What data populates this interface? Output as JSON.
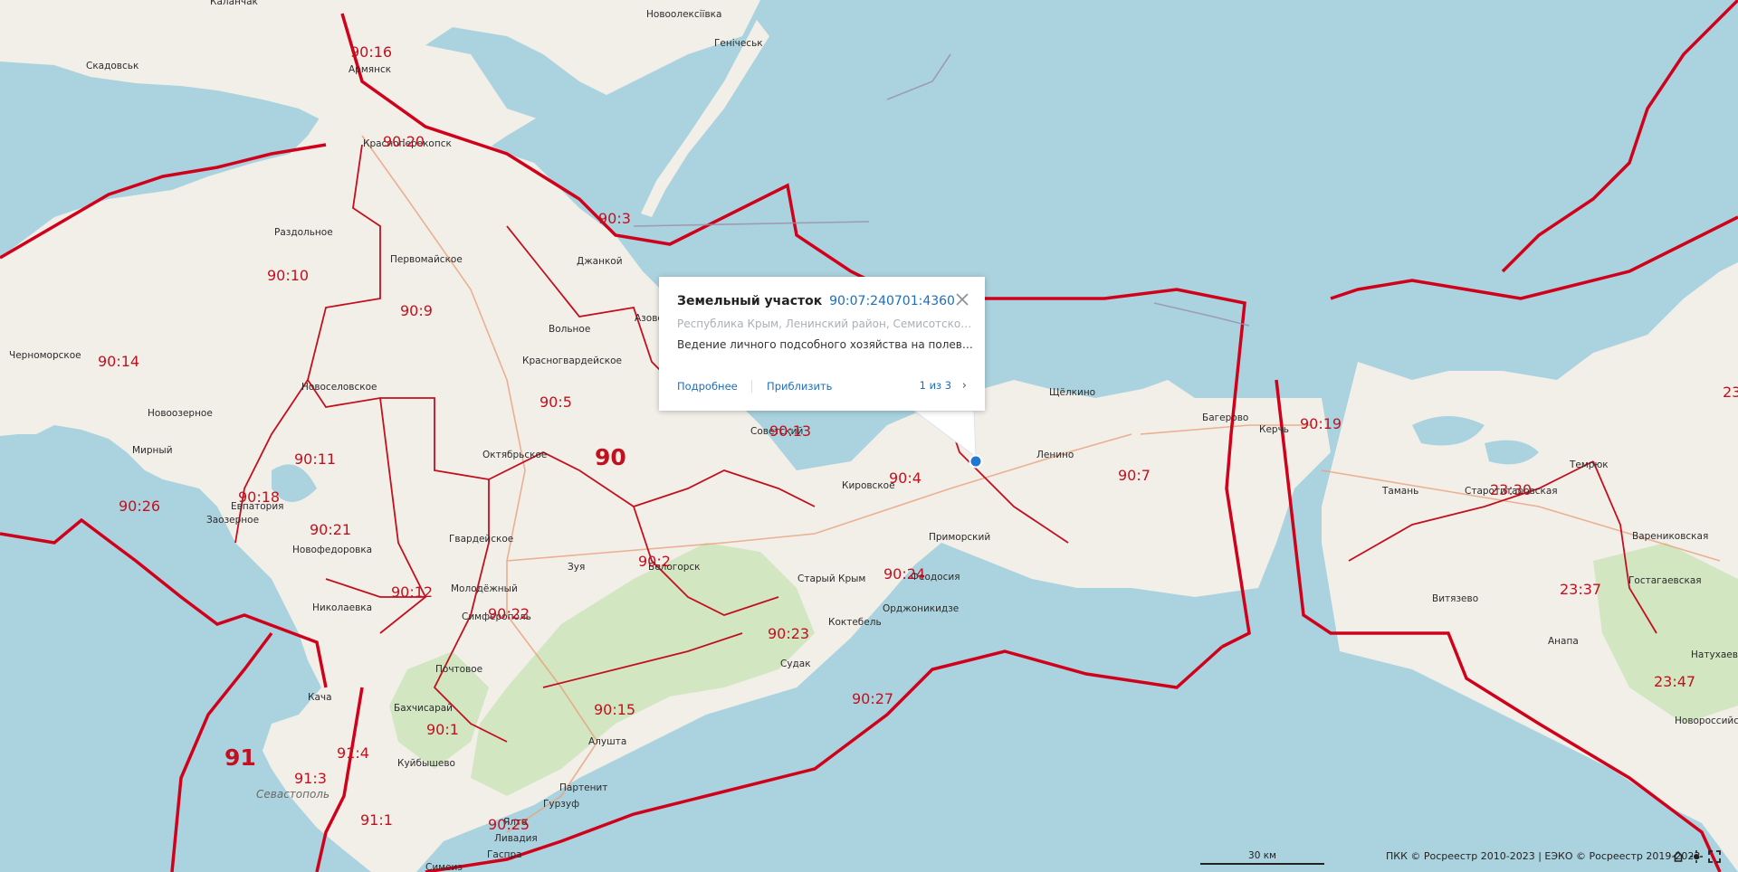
{
  "map": {
    "towns": [
      {
        "text": "Каланчак"
      },
      {
        "text": "Новоолексіївка"
      },
      {
        "text": "Генічеськ"
      },
      {
        "text": "Скадовськ"
      },
      {
        "text": "Армянск"
      },
      {
        "text": "Красноперекопск"
      },
      {
        "text": "Раздольное"
      },
      {
        "text": "Первомайское"
      },
      {
        "text": "Джанкой"
      },
      {
        "text": "Вольное"
      },
      {
        "text": "Азовское"
      },
      {
        "text": "Черноморское"
      },
      {
        "text": "Красногвардейское"
      },
      {
        "text": "Новоселовское"
      },
      {
        "text": "Новоозерное"
      },
      {
        "text": "Мирный"
      },
      {
        "text": "Октябрьское"
      },
      {
        "text": "Советский"
      },
      {
        "text": "Кировское"
      },
      {
        "text": "Ленино"
      },
      {
        "text": "Щёлкино"
      },
      {
        "text": "Багерово"
      },
      {
        "text": "Керчь"
      },
      {
        "text": "Евпатория"
      },
      {
        "text": "Заозерное"
      },
      {
        "text": "Новофедоровка"
      },
      {
        "text": "Гвардейское"
      },
      {
        "text": "Приморский"
      },
      {
        "text": "Зуя"
      },
      {
        "text": "Белогорск"
      },
      {
        "text": "Старый Крым"
      },
      {
        "text": "Феодосия"
      },
      {
        "text": "Орджоникидзе"
      },
      {
        "text": "Николаевка"
      },
      {
        "text": "Молодёжный"
      },
      {
        "text": "Симферополь"
      },
      {
        "text": "Коктебель"
      },
      {
        "text": "Почтовое"
      },
      {
        "text": "Судак"
      },
      {
        "text": "Кача"
      },
      {
        "text": "Бахчисарай"
      },
      {
        "text": "Куйбышево"
      },
      {
        "text": "Алушта"
      },
      {
        "text": "Севастополь"
      },
      {
        "text": "Партенит"
      },
      {
        "text": "Гурзуф"
      },
      {
        "text": "Ялта"
      },
      {
        "text": "Ливадия"
      },
      {
        "text": "Гаспра"
      },
      {
        "text": "Симеиз"
      },
      {
        "text": "Тамань"
      },
      {
        "text": "Старотитаровская"
      },
      {
        "text": "Темрюк"
      },
      {
        "text": "Варениковская"
      },
      {
        "text": "Витязево"
      },
      {
        "text": "Гостагаевская"
      },
      {
        "text": "Анапа"
      },
      {
        "text": "Натухаевская"
      },
      {
        "text": "Новороссийск"
      }
    ],
    "zones": [
      {
        "text": "90:16"
      },
      {
        "text": "90:20"
      },
      {
        "text": "90:3"
      },
      {
        "text": "90:10"
      },
      {
        "text": "90:9"
      },
      {
        "text": "90:14"
      },
      {
        "text": "90:5"
      },
      {
        "text": "90:11"
      },
      {
        "text": "90:13"
      },
      {
        "text": "90:4"
      },
      {
        "text": "90:7"
      },
      {
        "text": "90:19"
      },
      {
        "text": "90:26"
      },
      {
        "text": "90:18"
      },
      {
        "text": "90:21"
      },
      {
        "text": "90:2"
      },
      {
        "text": "90:24"
      },
      {
        "text": "90:12"
      },
      {
        "text": "90:22"
      },
      {
        "text": "90:23"
      },
      {
        "text": "90:27"
      },
      {
        "text": "90:15"
      },
      {
        "text": "90:1"
      },
      {
        "text": "91:4"
      },
      {
        "text": "91:3"
      },
      {
        "text": "91:1"
      },
      {
        "text": "90:25"
      },
      {
        "text": "23:30"
      },
      {
        "text": "23:37"
      },
      {
        "text": "23:47"
      },
      {
        "text": "23"
      }
    ],
    "regions": [
      {
        "text": "90"
      },
      {
        "text": "91"
      }
    ]
  },
  "popup": {
    "title": "Земельный участок",
    "cadastral_number": "90:07:240701:4360",
    "address": "Республика Крым, Ленинский район, Семисотское сельское поселение",
    "land_use": "Ведение личного подсобного хозяйства на полевых участках",
    "details_label": "Подробнее",
    "zoom_label": "Приблизить",
    "pager": "1 из 3"
  },
  "footer": {
    "scale_label": "30 км",
    "attribution": "ПКК © Росреестр 2010-2023 | ЕЭКО © Росреестр 2019-2023"
  },
  "colors": {
    "sea": "#aad3df",
    "land": "#f2efe9",
    "border": "#d0021b",
    "label": "#c3101e",
    "link": "#1a6fc1",
    "marker": "#1f78d1"
  }
}
